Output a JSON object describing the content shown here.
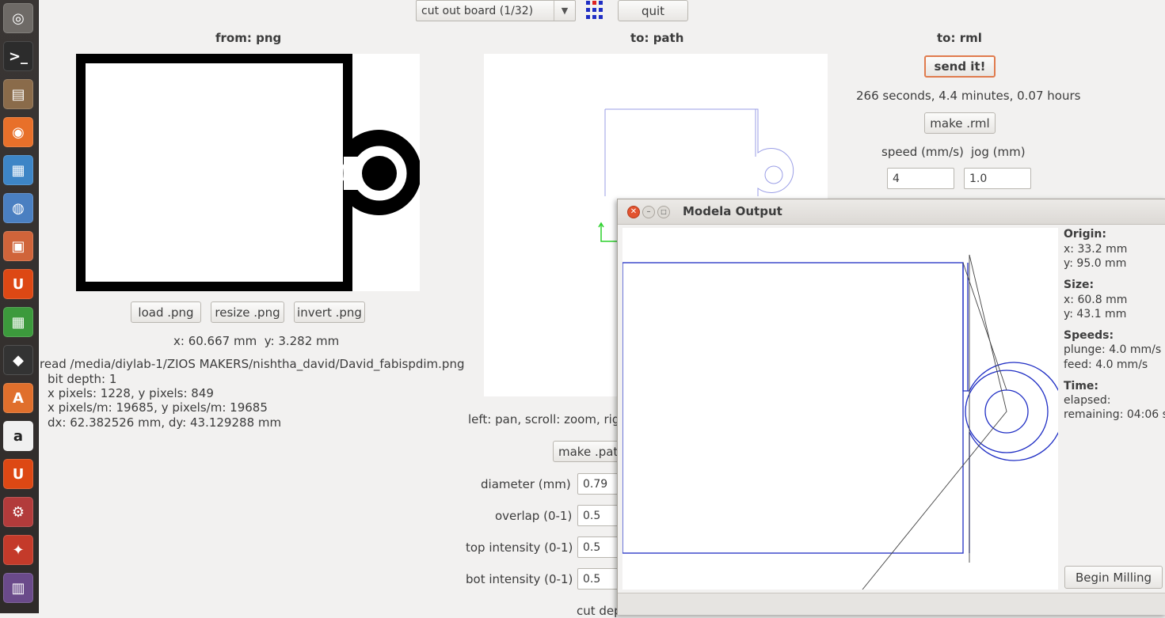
{
  "launcher": {
    "items": [
      {
        "name": "dash-icon",
        "glyph": "◎",
        "color": "#6e6a66"
      },
      {
        "name": "terminal-icon",
        "glyph": ">_",
        "color": "#2c2c2c"
      },
      {
        "name": "files-icon",
        "glyph": "▤",
        "color": "#8a6b4a"
      },
      {
        "name": "firefox-icon",
        "glyph": "◉",
        "color": "#e8702a"
      },
      {
        "name": "writer-icon",
        "glyph": "▦",
        "color": "#3d85c6"
      },
      {
        "name": "chromium-icon",
        "glyph": "◍",
        "color": "#4a7fc1"
      },
      {
        "name": "impress-icon",
        "glyph": "▣",
        "color": "#d0643a"
      },
      {
        "name": "ubuntu-one-icon",
        "glyph": "U",
        "color": "#dd4814"
      },
      {
        "name": "calc-icon",
        "glyph": "▦",
        "color": "#3c9a3c"
      },
      {
        "name": "inkscape-icon",
        "glyph": "◆",
        "color": "#333333"
      },
      {
        "name": "software-center-icon",
        "glyph": "A",
        "color": "#e06f2c"
      },
      {
        "name": "amazon-icon",
        "glyph": "a",
        "color": "#f0f0f0"
      },
      {
        "name": "ubuntu-one-music-icon",
        "glyph": "U",
        "color": "#dd4814"
      },
      {
        "name": "settings-icon",
        "glyph": "⚙",
        "color": "#b23b3b"
      },
      {
        "name": "fab-modules-icon",
        "glyph": "✦",
        "color": "#c43a2a"
      },
      {
        "name": "workspace-icon",
        "glyph": "▥",
        "color": "#6a4a8a"
      }
    ]
  },
  "toolbar": {
    "process_select": "cut out board (1/32)",
    "quit_label": "quit"
  },
  "from_panel": {
    "title": "from: png",
    "load_label": "load .png",
    "resize_label": "resize .png",
    "invert_label": "invert .png",
    "cursor": "x: 60.667 mm  y: 3.282 mm",
    "info": [
      "read /media/diylab-1/ZIOS MAKERS/nishtha_david/David_fabispdim.png",
      "bit depth: 1",
      "x pixels: 1228, y pixels: 849",
      "x pixels/m: 19685, y pixels/m: 19685",
      "dx: 62.382526 mm, dy: 43.129288 mm"
    ]
  },
  "path_panel": {
    "title": "to: path",
    "help": "left: pan, scroll: zoom, righ",
    "make_label": "make .path",
    "params": [
      {
        "label": "diameter (mm)",
        "value": "0.79"
      },
      {
        "label": "overlap (0-1)",
        "value": "0.5"
      },
      {
        "label": "top intensity (0-1)",
        "value": "0.5"
      },
      {
        "label": "bot intensity (0-1)",
        "value": "0.5"
      }
    ],
    "cut_partial": "cut dep"
  },
  "rml_panel": {
    "title": "to: rml",
    "send_label": "send it!",
    "time_estimate": "266 seconds, 4.4 minutes, 0.07 hours",
    "make_label": "make .rml",
    "speed_label": "speed (mm/s)",
    "jog_label": "jog (mm)",
    "speed_value": "4",
    "jog_value": "1.0"
  },
  "modela_window": {
    "title": "Modela Output",
    "origin_heading": "Origin:",
    "origin_x": "x: 33.2 mm",
    "origin_y": "y: 95.0 mm",
    "size_heading": "Size:",
    "size_x": "x: 60.8 mm",
    "size_y": "y: 43.1 mm",
    "speeds_heading": "Speeds:",
    "plunge": "plunge: 4.0 mm/s",
    "feed": "feed: 4.0 mm/s",
    "time_heading": "Time:",
    "elapsed": "elapsed:",
    "remaining": "remaining: 04:06 s",
    "begin_label": "Begin Milling"
  },
  "colors": {
    "path_line": "#9a9ee6",
    "modela_line": "#1f2ec4",
    "send_border": "#e07b4d"
  }
}
